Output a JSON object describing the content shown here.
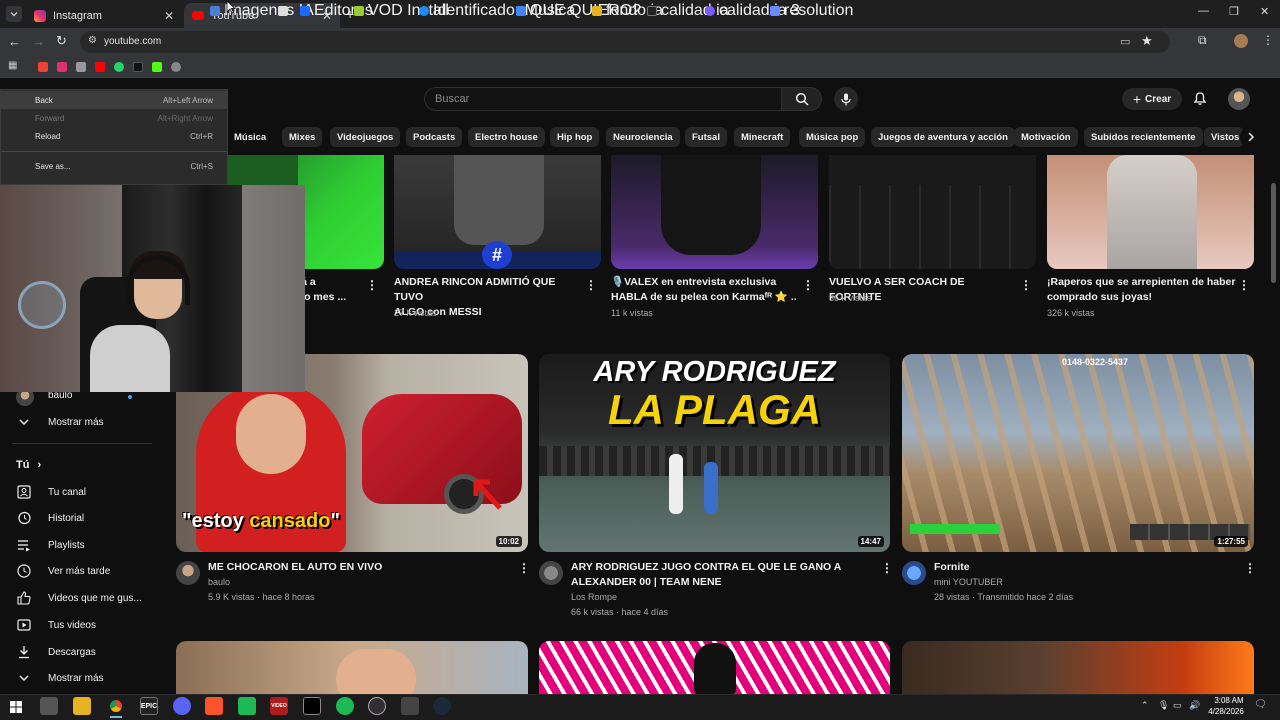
{
  "browser": {
    "tabs": [
      {
        "label": "Instagram",
        "active": false
      },
      {
        "label": "YouTube",
        "active": true
      }
    ],
    "address": "youtube.com",
    "bookmarks": [
      "Imagenes IA",
      "Editores",
      "VOD Install",
      "Identificador Musica",
      "QUE QUIERO?",
      "fondo ia",
      "calidad ia",
      "calidad ia 3",
      "resolution"
    ]
  },
  "context_menu": {
    "items": [
      {
        "label": "Back",
        "shortcut": "Alt+Left Arrow",
        "enabled": true
      },
      {
        "label": "Forward",
        "shortcut": "Alt+Right Arrow",
        "enabled": false
      },
      {
        "label": "Reload",
        "shortcut": "Ctrl+R",
        "enabled": true
      },
      {
        "label": "Save as...",
        "shortcut": "Ctrl+S",
        "enabled": true
      }
    ]
  },
  "youtube": {
    "search_placeholder": "Buscar",
    "create_label": "Crear",
    "chips": [
      "Música",
      "Mixes",
      "Videojuegos",
      "Podcasts",
      "Electro house",
      "Hip hop",
      "Neurociencia",
      "Futsal",
      "Minecraft",
      "Música pop",
      "Juegos de aventura y acción",
      "Motivación",
      "Subidos recientemente",
      "Vistos"
    ],
    "sidebar": {
      "subscription_name": "baulo",
      "show_more_1": "Mostrar más",
      "you_header": "Tú",
      "items": [
        "Tu canal",
        "Historial",
        "Playlists",
        "Ver más tarde",
        "Videos que me gus...",
        "Tus videos",
        "Descargas"
      ],
      "show_more_2": "Mostrar más"
    },
    "row1": [
      {
        "title": "zará a",
        "title2": "ximo mes ...",
        "views": ""
      },
      {
        "title": "ANDREA RINCON ADMITIÓ QUE TUVO",
        "title2": "ALGO con MESSI",
        "views": "27 k vistas"
      },
      {
        "title": "🎙️VALEX en entrevista exclusiva",
        "title2": "HABLA de su pelea con Karmaᶠᴿ ⭐ ...",
        "views": "11 k vistas"
      },
      {
        "title": "VUELVO A SER COACH DE FORTNITE",
        "title2": "",
        "views": "36 k vistas"
      },
      {
        "title": "¡Raperos que se arrepienten de haber",
        "title2": "comprado sus joyas!",
        "views": "326 k vistas"
      }
    ],
    "row2": [
      {
        "title": "ME CHOCARON EL AUTO EN VIVO",
        "title2": "",
        "channel": "baulo",
        "meta": "5.9 K vistas · hace 8 horas",
        "duration": "10:02",
        "thumb_caption_1": "\"estoy ",
        "thumb_caption_2": "cansado",
        "thumb_caption_3": "\""
      },
      {
        "title": "ARY RODRIGUEZ JUGO CONTRA EL QUE LE GANO A",
        "title2": "ALEXANDER 00 | TEAM NENE",
        "channel": "Los Rompe",
        "meta": "66 k vistas · hace 4 días",
        "duration": "14:47",
        "thumb_caption_1": "ARY RODRIGUEZ",
        "thumb_caption_2": "LA PLAGA"
      },
      {
        "title": "Fornite",
        "title2": "",
        "channel": "mini YOUTUBER",
        "meta": "28 vistas · Transmitido hace 2 días",
        "duration": "1:27:55",
        "thumb_caption_1": "0148-0322-5437"
      }
    ]
  },
  "taskbar": {
    "time": "3:08 AM",
    "date": "4/28/2026"
  },
  "colors": {
    "yt_bg": "#0f0f0f",
    "chip_bg": "#272727",
    "chrome_bg": "#35363a",
    "yt_red": "#ff0000",
    "caption_yellow": "#f5d20a"
  }
}
